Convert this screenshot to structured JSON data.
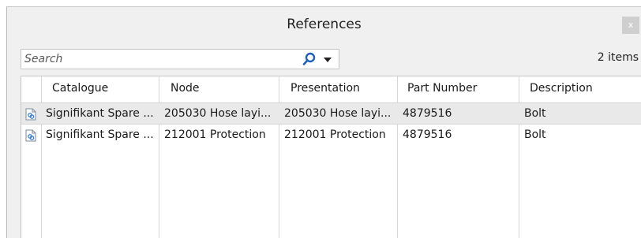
{
  "window": {
    "title": "References",
    "close_label": "x"
  },
  "toolbar": {
    "search_placeholder": "Search",
    "item_count": "2 items"
  },
  "table": {
    "columns": [
      "Catalogue",
      "Node",
      "Presentation",
      "Part Number",
      "Description"
    ],
    "rows": [
      {
        "catalogue": "Signifikant Spare ...",
        "node": "205030 Hose layi...",
        "presentation": "205030 Hose layi...",
        "part_number": "4879516",
        "description": "Bolt",
        "selected": true
      },
      {
        "catalogue": "Signifikant Spare ...",
        "node": "212001 Protection",
        "presentation": "212001 Protection",
        "part_number": "4879516",
        "description": "Bolt",
        "selected": false
      }
    ]
  },
  "icons": {
    "search": "search-icon",
    "dropdown": "chevron-down-icon",
    "row": "document-link-icon"
  },
  "colors": {
    "window_bg": "#f0f0f0",
    "accent": "#1f5fbf",
    "selected_row": "#e9e9e9"
  }
}
